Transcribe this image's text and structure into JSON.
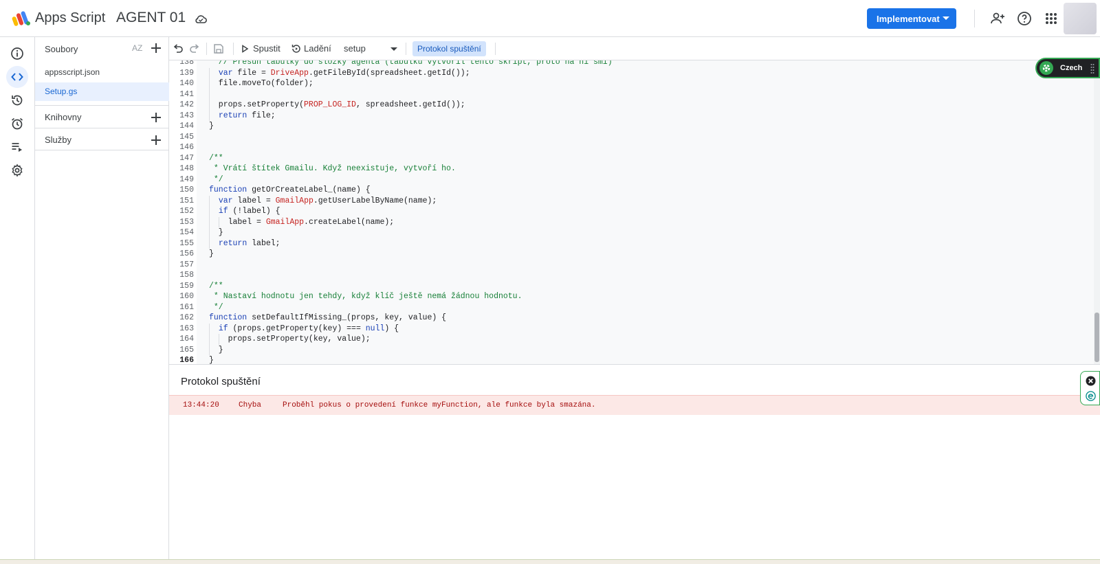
{
  "header": {
    "brand": "Apps Script",
    "project_title": "AGENT 01",
    "deploy_label": "Implementovat"
  },
  "files_panel": {
    "title": "Soubory",
    "sort_label": "AZ",
    "files": [
      "appsscript.json",
      "Setup.gs"
    ],
    "active_file": "Setup.gs",
    "sections": [
      "Knihovny",
      "Služby"
    ]
  },
  "toolbar": {
    "run_label": "Spustit",
    "debug_label": "Ladění",
    "function_name": "setup",
    "log_label": "Protokol spuštění"
  },
  "editor": {
    "active_line": 166,
    "lines": [
      {
        "n": 138,
        "text": "  // Přesun tabulky do složky agenta (tabulku vytvořil tento skript, proto na ni smí)"
      },
      {
        "n": 139,
        "text": "  var file = DriveApp.getFileById(spreadsheet.getId());"
      },
      {
        "n": 140,
        "text": "  file.moveTo(folder);"
      },
      {
        "n": 141,
        "text": ""
      },
      {
        "n": 142,
        "text": "  props.setProperty(PROP_LOG_ID, spreadsheet.getId());"
      },
      {
        "n": 143,
        "text": "  return file;"
      },
      {
        "n": 144,
        "text": "}"
      },
      {
        "n": 145,
        "text": ""
      },
      {
        "n": 146,
        "text": ""
      },
      {
        "n": 147,
        "text": "/**"
      },
      {
        "n": 148,
        "text": " * Vrátí štítek Gmailu. Když neexistuje, vytvoří ho."
      },
      {
        "n": 149,
        "text": " */"
      },
      {
        "n": 150,
        "text": "function getOrCreateLabel_(name) {"
      },
      {
        "n": 151,
        "text": "  var label = GmailApp.getUserLabelByName(name);"
      },
      {
        "n": 152,
        "text": "  if (!label) {"
      },
      {
        "n": 153,
        "text": "    label = GmailApp.createLabel(name);"
      },
      {
        "n": 154,
        "text": "  }"
      },
      {
        "n": 155,
        "text": "  return label;"
      },
      {
        "n": 156,
        "text": "}"
      },
      {
        "n": 157,
        "text": ""
      },
      {
        "n": 158,
        "text": ""
      },
      {
        "n": 159,
        "text": "/**"
      },
      {
        "n": 160,
        "text": " * Nastaví hodnotu jen tehdy, když klíč ještě nemá žádnou hodnotu."
      },
      {
        "n": 161,
        "text": " */"
      },
      {
        "n": 162,
        "text": "function setDefaultIfMissing_(props, key, value) {"
      },
      {
        "n": 163,
        "text": "  if (props.getProperty(key) === null) {"
      },
      {
        "n": 164,
        "text": "    props.setProperty(key, value);"
      },
      {
        "n": 165,
        "text": "  }"
      },
      {
        "n": 166,
        "text": "}"
      }
    ]
  },
  "log": {
    "title": "Protokol spuštění",
    "entries": [
      {
        "time": "13:44:20",
        "level": "Chyba",
        "message": "Proběhl pokus o provedení funkce myFunction, ale funkce byla smazána."
      }
    ]
  },
  "translate_widget": {
    "label": "Czech"
  },
  "colors": {
    "accent": "#1a73e8",
    "keyword": "#1a40b5",
    "comment": "#188038",
    "class": "#c5221f",
    "error_bg": "#fce8e6",
    "error_text": "#a50e0e"
  }
}
